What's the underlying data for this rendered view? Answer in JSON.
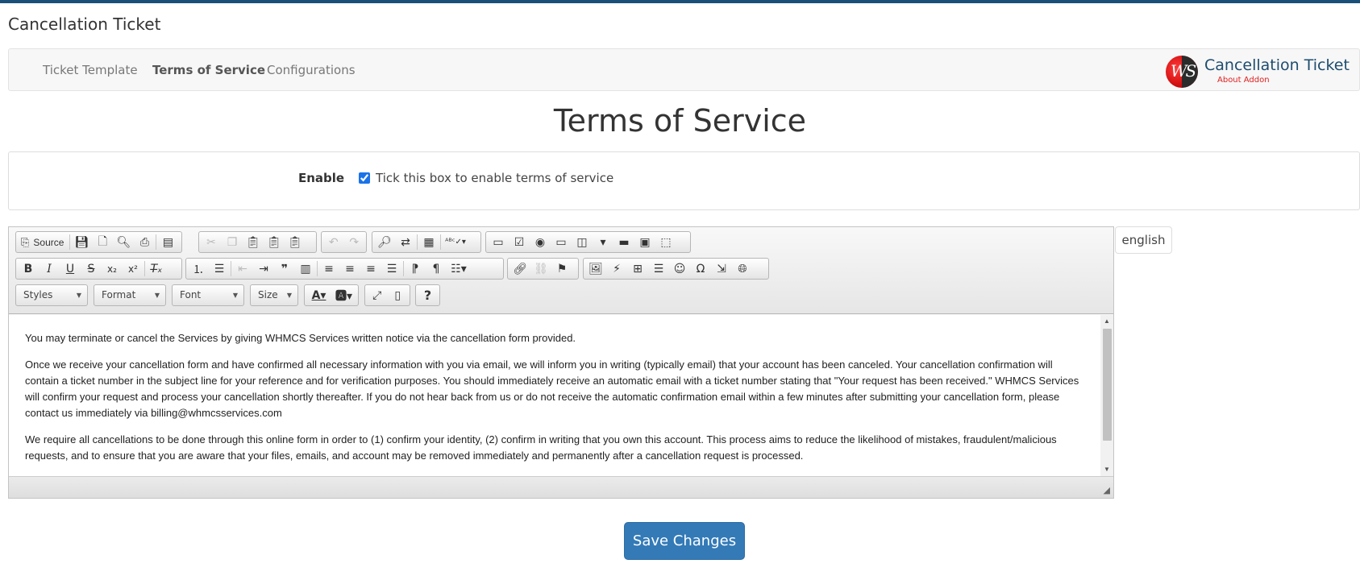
{
  "page": {
    "header": "Cancellation Ticket",
    "title": "Terms of Service",
    "accent_color": "#337ab7",
    "top_bar_color": "#1a4f7a"
  },
  "nav": {
    "tabs": [
      {
        "label": "Ticket Template",
        "active": false
      },
      {
        "label": "Terms of Service",
        "active": true
      },
      {
        "label": "Configurations",
        "active": false
      }
    ]
  },
  "brand": {
    "logo_letters": "WS",
    "title": "Cancellation Ticket",
    "subtitle": "About Addon"
  },
  "enable": {
    "label": "Enable",
    "checked": true,
    "text": "Tick this box to enable terms of service"
  },
  "language_tab": "english",
  "editor": {
    "toolbar": {
      "source_label": "Source",
      "styles_label": "Styles",
      "format_label": "Format",
      "font_label": "Font",
      "size_label": "Size"
    },
    "paragraphs": [
      "You may terminate or cancel the Services by giving WHMCS Services written notice via the cancellation form provided.",
      "Once we receive your cancellation form and have confirmed all necessary information with you via email, we will inform you in writing (typically email) that your account has been canceled. Your cancellation confirmation will contain a ticket number in the subject line for your reference and for verification purposes. You should immediately receive an automatic email with a ticket number stating that \"Your request has been received.\" WHMCS Services will confirm your request and process your cancellation shortly thereafter. If you do not hear back from us or do not receive the automatic confirmation email within a few minutes after submitting your cancellation form, please contact us immediately via billing@whmcsservices.com",
      "We require all cancellations to be done through this online form in order to (1) confirm your identity, (2) confirm in writing that you own this account. This process aims to reduce the likelihood of mistakes, fraudulent/malicious requests, and to ensure that you are aware that your files, emails, and account may be removed immediately and permanently after a cancellation request is processed."
    ]
  },
  "save_button": "Save Changes"
}
